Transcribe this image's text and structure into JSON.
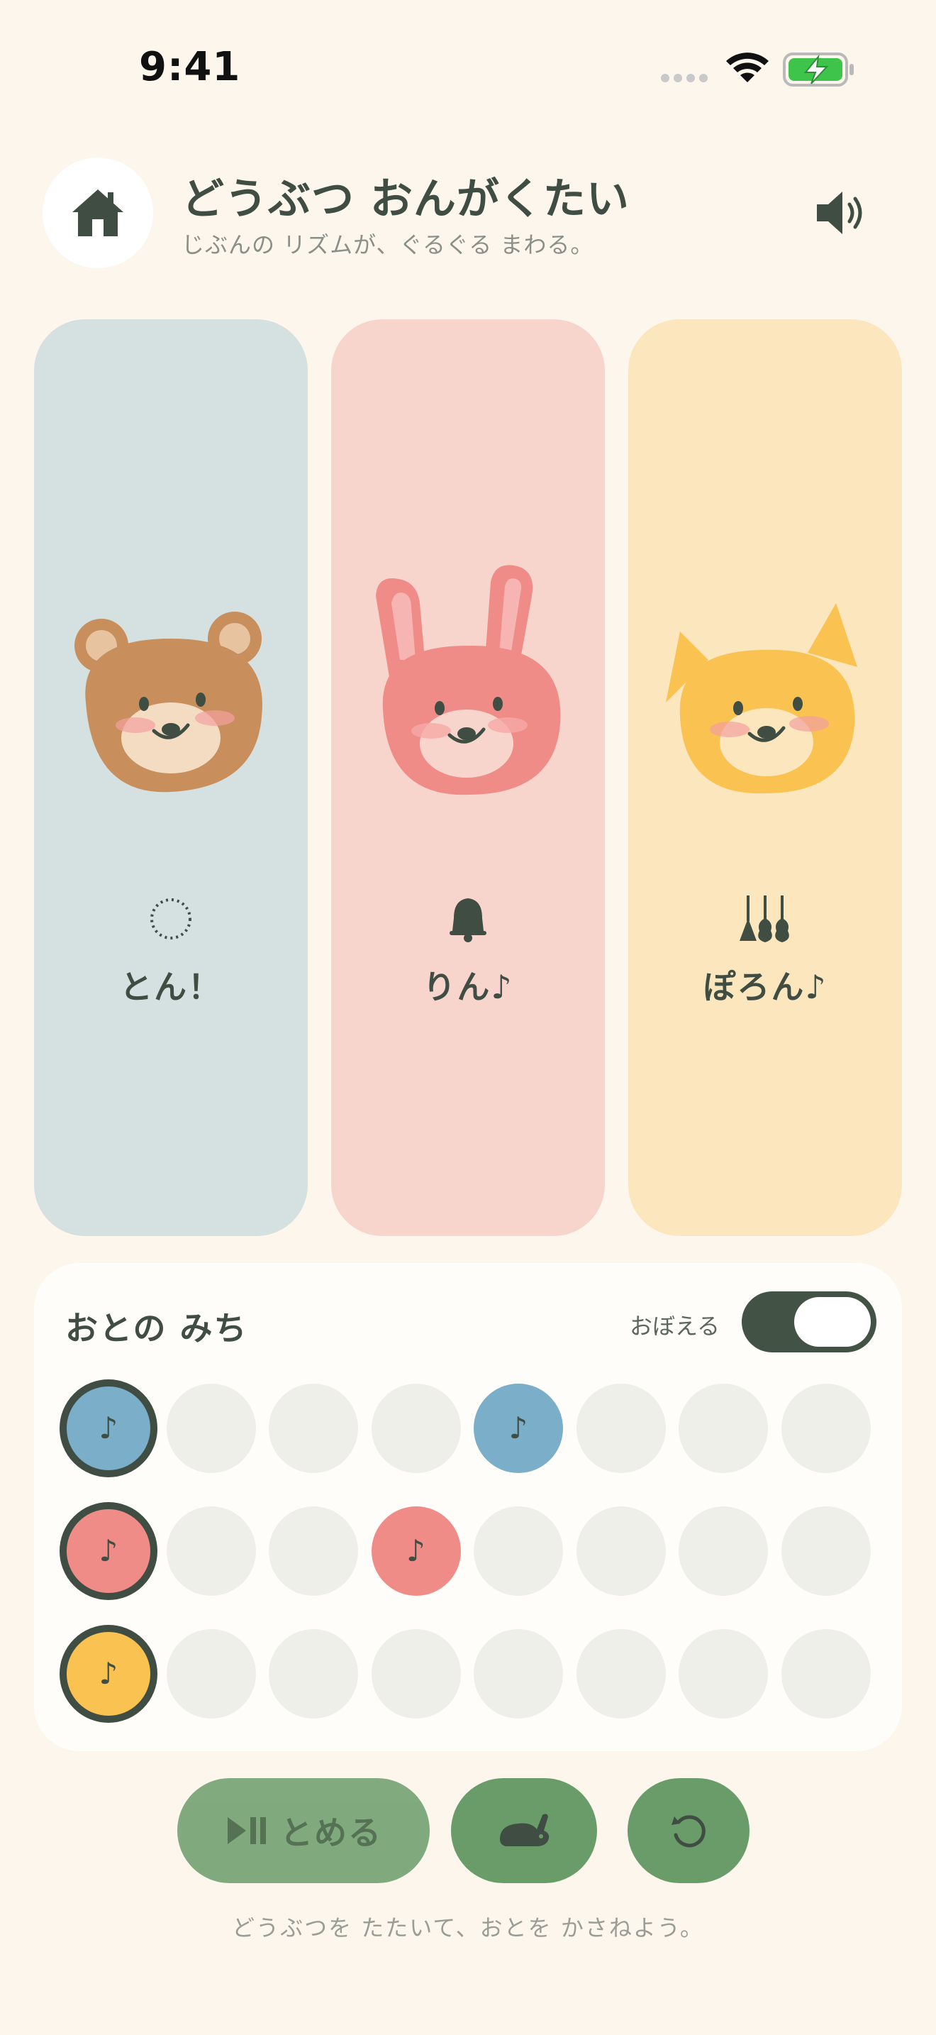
{
  "status_bar": {
    "time": "9:41",
    "icons": [
      "signal-dots-icon",
      "wifi-icon",
      "battery-charging-icon"
    ]
  },
  "header": {
    "title": "どうぶつ おんがくたい",
    "subtitle": "じぶんの リズムが、ぐるぐる まわる。",
    "home_icon": "home-icon",
    "sound_icon": "speaker-icon"
  },
  "animals": [
    {
      "name": "bear",
      "label": "とん！",
      "icon": "dotted-circle-icon",
      "color": "#c88f5d",
      "card_color": "#d5e0e0"
    },
    {
      "name": "bunny",
      "label": "りん♪",
      "icon": "bell-icon",
      "color": "#f08c88",
      "card_color": "#f7d5cc"
    },
    {
      "name": "cat",
      "label": "ぽろん♪",
      "icon": "guitars-icon",
      "color": "#f9c251",
      "card_color": "#fce6bd"
    }
  ],
  "sequencer": {
    "title": "おとの みち",
    "memory_label": "おぼえる",
    "memory_on": true,
    "note_symbol": "♪",
    "rows": [
      {
        "animal": "bear",
        "color": "#7aaec9",
        "steps": [
          1,
          0,
          0,
          0,
          1,
          0,
          0,
          0
        ]
      },
      {
        "animal": "bunny",
        "color": "#f08c88",
        "steps": [
          1,
          0,
          0,
          1,
          0,
          0,
          0,
          0
        ]
      },
      {
        "animal": "cat",
        "color": "#f9c251",
        "steps": [
          1,
          0,
          0,
          0,
          0,
          0,
          0,
          0
        ]
      }
    ]
  },
  "controls": {
    "stop_label": "とめる",
    "stop_icon": "play-pause-icon",
    "speed_icon": "rabbit-icon",
    "reset_icon": "reset-icon"
  },
  "hint": "どうぶつを たたいて、おとを かさねよう。"
}
